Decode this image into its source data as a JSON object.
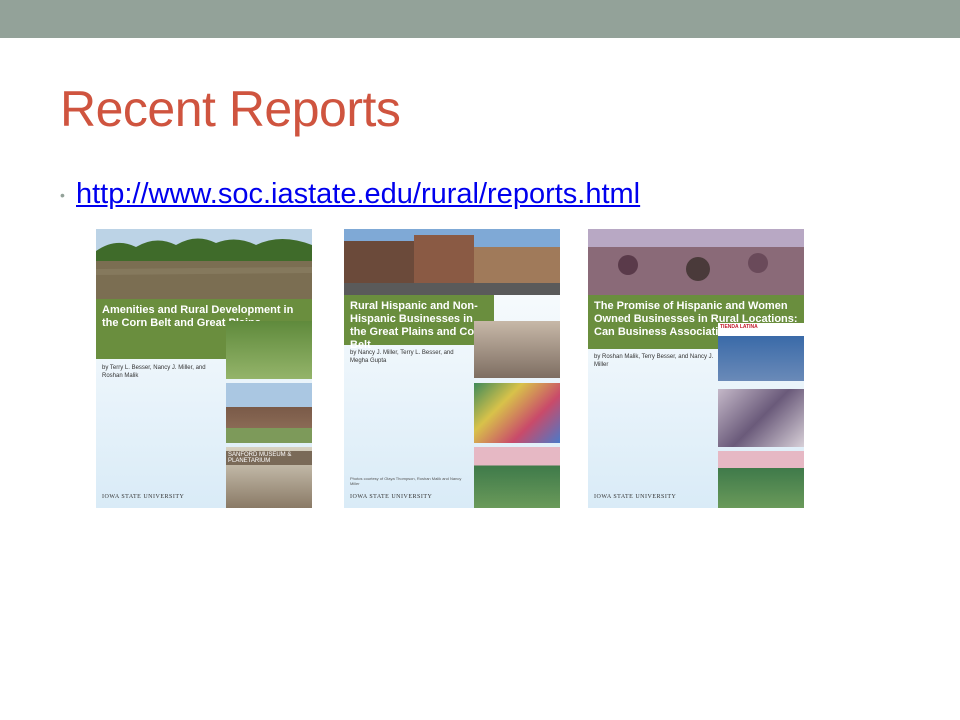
{
  "slide": {
    "title": "Recent Reports",
    "link": "http://www.soc.iastate.edu/rural/reports.html"
  },
  "reports": [
    {
      "title": "Amenities and Rural Development in the Corn Belt and Great Plains",
      "authors": "by Terry L. Besser, Nancy J. Miller, and Roshan Malik",
      "publisher": "IOWA STATE UNIVERSITY",
      "sign_text": "SANFORD MUSEUM & PLANETARIUM"
    },
    {
      "title": "Rural Hispanic and Non-Hispanic Businesses in the Great Plains and Corn Belt",
      "authors": "by Nancy J. Miller, Terry L. Besser, and Megha Gupta",
      "credits": "Photos courtesy of Olaya Thompson, Roshan Malik and Nancy Miller",
      "publisher": "IOWA STATE UNIVERSITY"
    },
    {
      "title": "The Promise of Hispanic and Women Owned Businesses in Rural Locations: Can Business Associations Help?",
      "authors": "by Roshan Malik, Terry Besser, and Nancy J. Miller",
      "publisher": "IOWA STATE UNIVERSITY",
      "sign_text": "TIENDA LATINA"
    }
  ],
  "colors": {
    "topbar": "#93a299",
    "title": "#cf543f",
    "link": "#0000ee",
    "cover_band": "#6a8e3e"
  }
}
